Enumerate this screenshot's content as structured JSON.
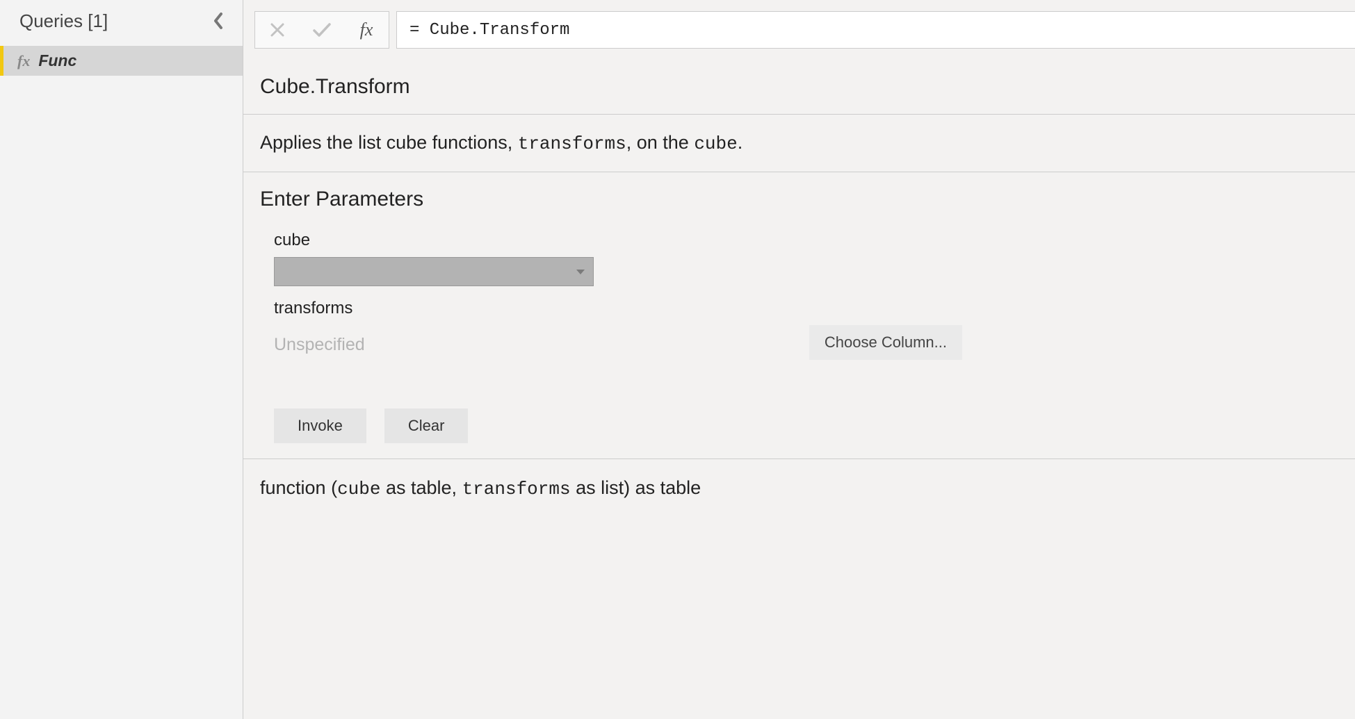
{
  "sidebar": {
    "title": "Queries [1]",
    "items": [
      {
        "name": "Func"
      }
    ]
  },
  "formula_bar": {
    "value": "= Cube.Transform"
  },
  "function": {
    "name": "Cube.Transform",
    "description_prefix": "Applies the list cube functions, ",
    "description_code1": "transforms",
    "description_mid": ", on the ",
    "description_code2": "cube",
    "description_suffix": "."
  },
  "parameters": {
    "heading": "Enter Parameters",
    "items": [
      {
        "label": "cube"
      },
      {
        "label": "transforms",
        "value_placeholder": "Unspecified"
      }
    ],
    "choose_column_label": "Choose Column...",
    "invoke_label": "Invoke",
    "clear_label": "Clear"
  },
  "signature": {
    "prefix": "function (",
    "p1": "cube",
    "p1_type": " as table, ",
    "p2": "transforms",
    "p2_type": " as list) as table"
  }
}
